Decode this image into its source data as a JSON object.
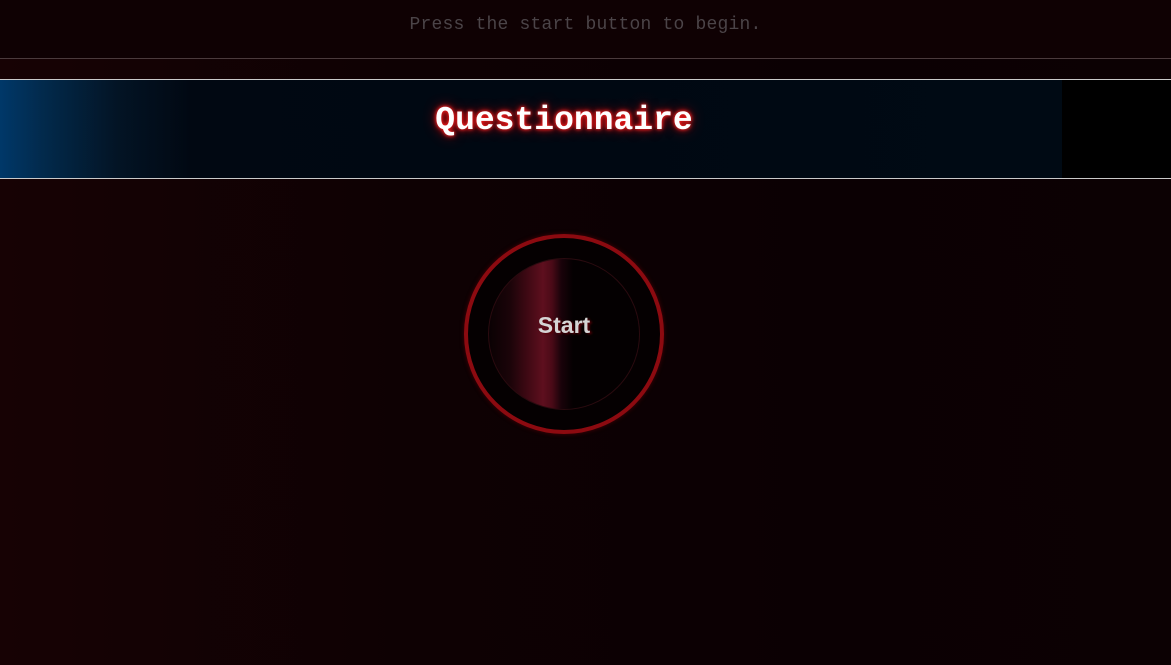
{
  "status": {
    "instruction": "Press the start button to begin."
  },
  "banner": {
    "title": "Questionnaire"
  },
  "start": {
    "label": "Start"
  },
  "colors": {
    "background": "#0e0103",
    "banner_blue": "#003869",
    "title_glow": "#ff1a1a",
    "button_ring": "#8c0a10",
    "button_highlight": "#5e0f1e",
    "instruction_text": "#4b4448"
  }
}
